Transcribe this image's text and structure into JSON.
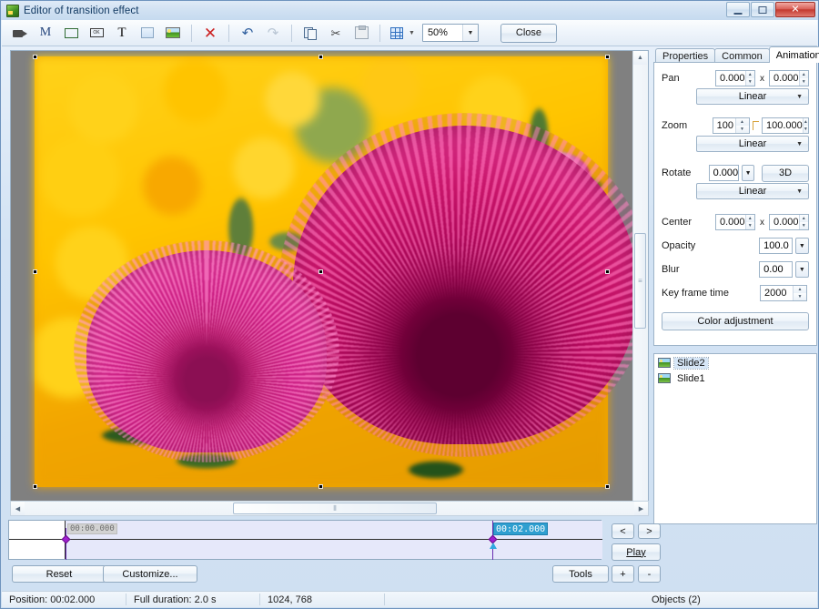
{
  "window": {
    "title": "Editor of transition effect",
    "icon": "app-photo-icon",
    "controls": {
      "minimize": "–",
      "maximize": "□",
      "close": "✕"
    }
  },
  "toolbar": {
    "items": [
      {
        "name": "video-object-icon",
        "glyph": "camcorder"
      },
      {
        "name": "mask-object-icon",
        "glyph": "M"
      },
      {
        "name": "frame-object-icon",
        "glyph": "rectangle"
      },
      {
        "name": "button-object-icon",
        "glyph": "button"
      },
      {
        "name": "text-object-icon",
        "glyph": "T"
      },
      {
        "name": "shape-object-icon",
        "glyph": "square"
      },
      {
        "name": "image-object-icon",
        "glyph": "picture"
      },
      {
        "name": "delete-icon",
        "glyph": "X"
      },
      {
        "name": "undo-icon",
        "glyph": "undo"
      },
      {
        "name": "redo-icon",
        "glyph": "redo"
      },
      {
        "name": "copy-icon",
        "glyph": "copy"
      },
      {
        "name": "cut-icon",
        "glyph": "scissors"
      },
      {
        "name": "paste-icon",
        "glyph": "paste"
      },
      {
        "name": "grid-icon",
        "glyph": "grid"
      }
    ],
    "zoom_value": "50%",
    "close_label": "Close"
  },
  "canvas": {
    "image_alt": "two magenta aster flowers on a yellow flowerbed background",
    "selected": true
  },
  "panel": {
    "tabs": [
      {
        "label": "Properties",
        "active": false
      },
      {
        "label": "Common",
        "active": false
      },
      {
        "label": "Animation",
        "active": true
      }
    ],
    "animation": {
      "pan_label": "Pan",
      "pan_x": "0.000",
      "pan_sep": "x",
      "pan_y": "0.000",
      "pan_mode": "Linear",
      "zoom_label": "Zoom",
      "zoom_x": "100",
      "zoom_y": "100.000",
      "zoom_mode": "Linear",
      "rotate_label": "Rotate",
      "rotate_value": "0.000",
      "rotate_3d": "3D",
      "rotate_mode": "Linear",
      "center_label": "Center",
      "center_x": "0.000",
      "center_sep": "x",
      "center_y": "0.000",
      "opacity_label": "Opacity",
      "opacity_value": "100.0",
      "blur_label": "Blur",
      "blur_value": "0.00",
      "keyframe_label": "Key frame time",
      "keyframe_value": "2000",
      "color_adjustment": "Color adjustment"
    },
    "slides": [
      {
        "label": "Slide2",
        "selected": true
      },
      {
        "label": "Slide1",
        "selected": false
      }
    ]
  },
  "timeline": {
    "start_marker": "00:00.000",
    "end_marker": "00:02.000",
    "prev_label": "<",
    "next_label": ">",
    "play_label": "Play",
    "tools_label": "Tools",
    "add_label": "+",
    "remove_label": "-",
    "reset_label": "Reset",
    "customize_label": "Customize..."
  },
  "statusbar": {
    "position": "Position:  00:02.000",
    "duration": "Full duration:  2.0 s",
    "size": "1024, 768",
    "objects": "Objects (2)"
  },
  "colors": {
    "accent": "#2f9fd0",
    "keyframe": "#a020d0",
    "chrome": "#cfe0f2",
    "close_red": "#c33a30"
  }
}
